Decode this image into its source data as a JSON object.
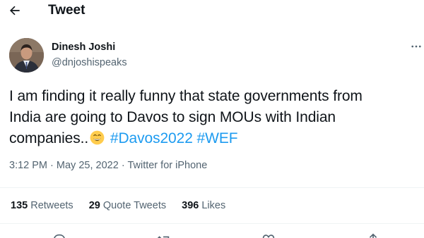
{
  "header": {
    "back_icon": "arrow-left-icon",
    "title": "Tweet"
  },
  "author": {
    "avatar_icon": "profile-photo",
    "display_name": "Dinesh Joshi",
    "handle": "@dnjoshispeaks",
    "more_icon": "more-horizontal-icon"
  },
  "tweet": {
    "line1": "I am finding it really funny that state governments from",
    "line2": "India are going to Davos to sign MOUs with Indian",
    "line3_text": "companies..",
    "emoji_icon": "grinning-face-emoji",
    "hashtag1": "#Davos2022",
    "hashtag2": "#WEF"
  },
  "meta": {
    "time": "3:12 PM",
    "separator1": "·",
    "date": "May 25, 2022",
    "separator2": "·",
    "source": "Twitter for iPhone"
  },
  "stats": {
    "retweets_count": "135",
    "retweets_label": "Retweets",
    "quotes_count": "29",
    "quotes_label": "Quote Tweets",
    "likes_count": "396",
    "likes_label": "Likes"
  },
  "actions": [
    "reply-icon",
    "retweet-icon",
    "like-icon",
    "share-icon"
  ],
  "colors": {
    "accent": "#1d9bf0",
    "text": "#0f1419",
    "secondary": "#536471",
    "divider": "#eff3f4"
  }
}
